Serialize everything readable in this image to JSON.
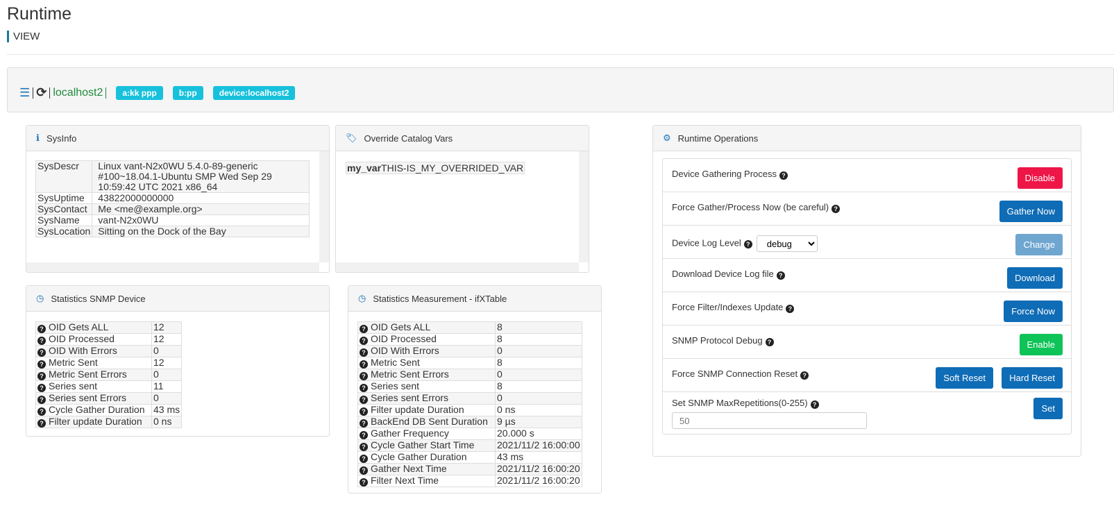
{
  "header": {
    "title": "Runtime",
    "subtitle": "VIEW"
  },
  "toolbar": {
    "host": "localhost2",
    "tags": [
      "a:kk ppp",
      "b:pp",
      "device:localhost2"
    ]
  },
  "sysinfo": {
    "title": "SysInfo",
    "rows": [
      {
        "k": "SysDescr",
        "v": "Linux vant-N2x0WU 5.4.0-89-generic #100~18.04.1-Ubuntu SMP Wed Sep 29 10:59:42 UTC 2021 x86_64"
      },
      {
        "k": "SysUptime",
        "v": "43822000000000"
      },
      {
        "k": "SysContact",
        "v": "Me <me@example.org>"
      },
      {
        "k": "SysName",
        "v": "vant-N2x0WU"
      },
      {
        "k": "SysLocation",
        "v": "Sitting on the Dock of the Bay"
      }
    ]
  },
  "override": {
    "title": "Override Catalog Vars",
    "key": "my_var",
    "value": "THIS-IS_MY_OVERRIDED_VAR"
  },
  "stats_device": {
    "title": "Statistics SNMP Device",
    "rows": [
      {
        "k": "OID Gets ALL",
        "v": "12"
      },
      {
        "k": "OID Processed",
        "v": "12"
      },
      {
        "k": "OID With Errors",
        "v": "0"
      },
      {
        "k": "Metric Sent",
        "v": "12"
      },
      {
        "k": "Metric Sent Errors",
        "v": "0"
      },
      {
        "k": "Series sent",
        "v": "11"
      },
      {
        "k": "Series sent Errors",
        "v": "0"
      },
      {
        "k": "Cycle Gather Duration",
        "v": "43 ms"
      },
      {
        "k": "Filter update Duration",
        "v": "0 ns"
      }
    ]
  },
  "stats_meas": {
    "title": "Statistics Measurement - ifXTable",
    "rows": [
      {
        "k": "OID Gets ALL",
        "v": "8"
      },
      {
        "k": "OID Processed",
        "v": "8"
      },
      {
        "k": "OID With Errors",
        "v": "0"
      },
      {
        "k": "Metric Sent",
        "v": "8"
      },
      {
        "k": "Metric Sent Errors",
        "v": "0"
      },
      {
        "k": "Series sent",
        "v": "8"
      },
      {
        "k": "Series sent Errors",
        "v": "0"
      },
      {
        "k": "Filter update Duration",
        "v": "0 ns"
      },
      {
        "k": "BackEnd DB Sent Duration",
        "v": "9 µs"
      },
      {
        "k": "Gather Frequency",
        "v": "20.000 s"
      },
      {
        "k": "Cycle Gather Start Time",
        "v": "2021/11/2 16:00:00"
      },
      {
        "k": "Cycle Gather Duration",
        "v": "43 ms"
      },
      {
        "k": "Gather Next Time",
        "v": "2021/11/2 16:00:20"
      },
      {
        "k": "Filter Next Time",
        "v": "2021/11/2 16:00:20"
      }
    ]
  },
  "ops": {
    "title": "Runtime Operations",
    "rows": [
      {
        "label": "Device Gathering Process",
        "buttons": [
          {
            "text": "Disable",
            "color": "#ee1547"
          }
        ]
      },
      {
        "label": "Force Gather/Process Now (be careful)",
        "buttons": [
          {
            "text": "Gather Now",
            "color": "#0f6cb6"
          }
        ]
      },
      {
        "label": "Device Log Level",
        "select": "debug",
        "buttons": [
          {
            "text": "Change",
            "color": "#6ea6d0"
          }
        ]
      },
      {
        "label": "Download Device Log file",
        "buttons": [
          {
            "text": "Download",
            "color": "#0f6cb6"
          }
        ]
      },
      {
        "label": "Force Filter/Indexes Update",
        "buttons": [
          {
            "text": "Force Now",
            "color": "#0f6cb6"
          }
        ]
      },
      {
        "label": "SNMP Protocol Debug",
        "buttons": [
          {
            "text": "Enable",
            "color": "#0ec358"
          }
        ]
      },
      {
        "label": "Force SNMP Connection Reset",
        "buttons": [
          {
            "text": "Soft Reset",
            "color": "#0f6cb6"
          },
          {
            "text": "Hard Reset",
            "color": "#0f6cb6"
          }
        ]
      },
      {
        "label": "Set SNMP MaxRepetitions(0-255)",
        "input_placeholder": "50",
        "buttons": [
          {
            "text": "Set",
            "color": "#0f6cb6"
          }
        ]
      }
    ]
  }
}
